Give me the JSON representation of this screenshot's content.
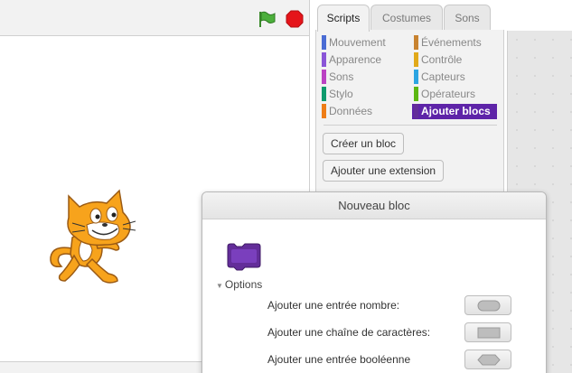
{
  "stage": {
    "controls": {
      "green_flag": "green-flag-icon",
      "stop": "stop-sign-icon"
    },
    "sprite": "scratch-cat"
  },
  "tabs": [
    {
      "label": "Scripts",
      "active": true
    },
    {
      "label": "Costumes",
      "active": false
    },
    {
      "label": "Sons",
      "active": false
    }
  ],
  "categories_left": [
    {
      "label": "Mouvement",
      "color": "#4a6cd4"
    },
    {
      "label": "Apparence",
      "color": "#8a55d7"
    },
    {
      "label": "Sons",
      "color": "#bb42c3"
    },
    {
      "label": "Stylo",
      "color": "#0e9a6c"
    },
    {
      "label": "Données",
      "color": "#ee7d16"
    }
  ],
  "categories_right": [
    {
      "label": "Événements",
      "color": "#c88330"
    },
    {
      "label": "Contrôle",
      "color": "#e1a91a"
    },
    {
      "label": "Capteurs",
      "color": "#2ca5e2"
    },
    {
      "label": "Opérateurs",
      "color": "#5cb712"
    },
    {
      "label": "Ajouter blocs",
      "color": "#632d99",
      "selected": true
    }
  ],
  "palette": {
    "make_block": "Créer un bloc",
    "add_extension": "Ajouter une extension"
  },
  "dialog": {
    "title": "Nouveau bloc",
    "block_color": "#632d99",
    "options_label": "Options",
    "options": [
      {
        "label": "Ajouter une entrée nombre:",
        "shape": "number-input-icon"
      },
      {
        "label": "Ajouter une chaîne de caractères:",
        "shape": "string-input-icon"
      },
      {
        "label": "Ajouter une entrée booléenne",
        "shape": "boolean-input-icon"
      }
    ]
  }
}
